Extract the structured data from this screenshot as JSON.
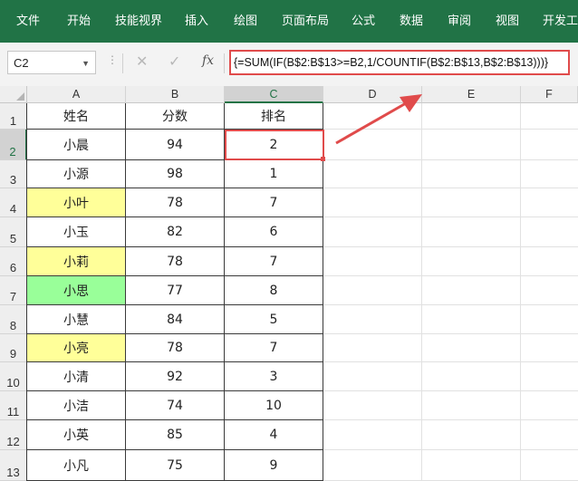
{
  "ribbon": {
    "tabs": [
      "文件",
      "开始",
      "技能视界",
      "插入",
      "绘图",
      "页面布局",
      "公式",
      "数据",
      "审阅",
      "视图",
      "开发工具"
    ]
  },
  "formula_bar": {
    "name_box": "C2",
    "fx_label": "fx",
    "formula": "{=SUM(IF(B$2:B$13>=B2,1/COUNTIF(B$2:B$13,B$2:B$13)))}"
  },
  "sheet": {
    "columns": [
      "A",
      "B",
      "C",
      "D",
      "E",
      "F"
    ],
    "rows": [
      "1",
      "2",
      "3",
      "4",
      "5",
      "6",
      "7",
      "8",
      "9",
      "10",
      "11",
      "12",
      "13"
    ],
    "selected_cell": "C2",
    "header": [
      "姓名",
      "分数",
      "排名"
    ],
    "data": [
      {
        "name": "小晨",
        "score": "94",
        "rank": "2",
        "fill": ""
      },
      {
        "name": "小源",
        "score": "98",
        "rank": "1",
        "fill": ""
      },
      {
        "name": "小叶",
        "score": "78",
        "rank": "7",
        "fill": "#ffff99"
      },
      {
        "name": "小玉",
        "score": "82",
        "rank": "6",
        "fill": ""
      },
      {
        "name": "小莉",
        "score": "78",
        "rank": "7",
        "fill": "#ffff99"
      },
      {
        "name": "小思",
        "score": "77",
        "rank": "8",
        "fill": "#99ff99"
      },
      {
        "name": "小慧",
        "score": "84",
        "rank": "5",
        "fill": ""
      },
      {
        "name": "小亮",
        "score": "78",
        "rank": "7",
        "fill": "#ffff99"
      },
      {
        "name": "小清",
        "score": "92",
        "rank": "3",
        "fill": ""
      },
      {
        "name": "小洁",
        "score": "74",
        "rank": "10",
        "fill": ""
      },
      {
        "name": "小英",
        "score": "85",
        "rank": "4",
        "fill": ""
      },
      {
        "name": "小凡",
        "score": "75",
        "rank": "9",
        "fill": ""
      }
    ]
  },
  "colors": {
    "ribbon": "#217346",
    "annotation": "#e04b4b"
  }
}
